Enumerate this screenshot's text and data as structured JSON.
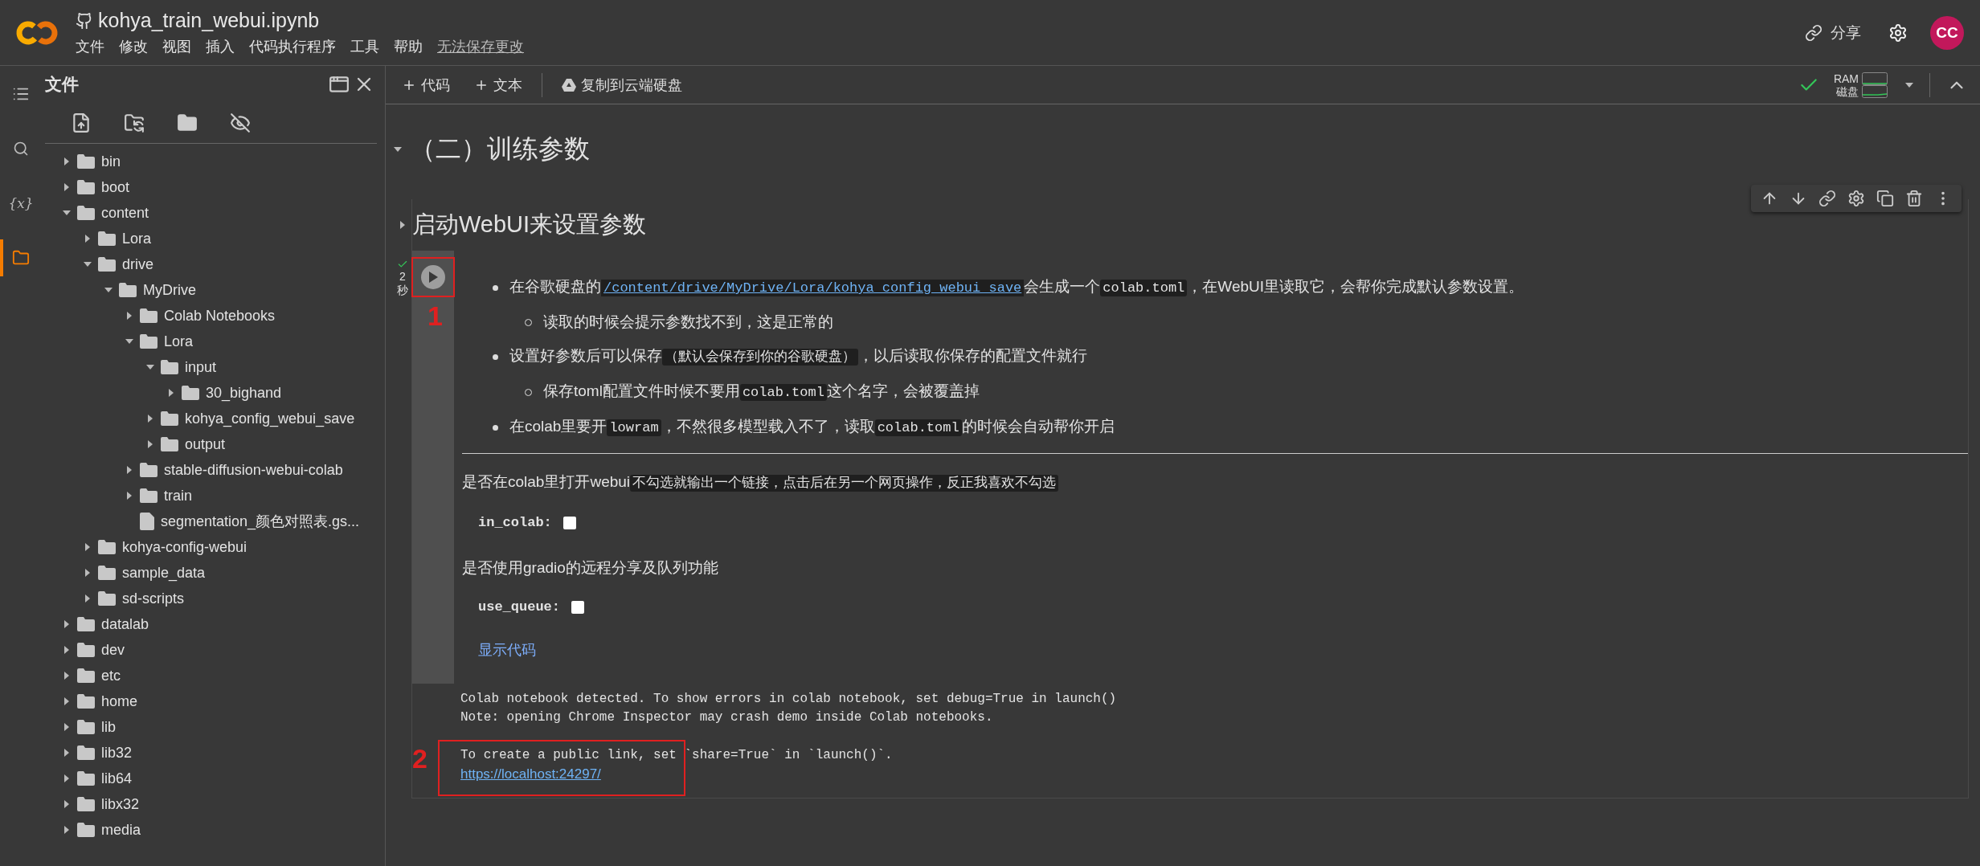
{
  "app": {
    "title": "kohya_train_webui.ipynb",
    "menu": [
      "文件",
      "修改",
      "视图",
      "插入",
      "代码执行程序",
      "工具",
      "帮助"
    ],
    "save_notice": "无法保存更改",
    "share": "分享",
    "avatar": "CC"
  },
  "toolbar": {
    "add_code": "代码",
    "add_text": "文本",
    "copy_to_drive": "复制到云端硬盘",
    "ram_label": "RAM",
    "disk_label": "磁盘",
    "connected": true
  },
  "rail": [
    {
      "kind": "toc",
      "selected": false
    },
    {
      "kind": "search",
      "selected": false
    },
    {
      "kind": "variables",
      "selected": false,
      "glyph": "{x}"
    },
    {
      "kind": "files",
      "selected": true
    }
  ],
  "sidebar": {
    "title": "文件"
  },
  "file_tree": [
    {
      "name": "bin",
      "kind": "folder",
      "expanded": false
    },
    {
      "name": "boot",
      "kind": "folder",
      "expanded": false
    },
    {
      "name": "content",
      "kind": "folder",
      "expanded": true,
      "children": [
        {
          "name": "Lora",
          "kind": "folder",
          "expanded": false
        },
        {
          "name": "drive",
          "kind": "folder",
          "expanded": true,
          "children": [
            {
              "name": "MyDrive",
              "kind": "folder",
              "expanded": true,
              "children": [
                {
                  "name": "Colab Notebooks",
                  "kind": "folder",
                  "expanded": false
                },
                {
                  "name": "Lora",
                  "kind": "folder",
                  "expanded": true,
                  "children": [
                    {
                      "name": "input",
                      "kind": "folder",
                      "expanded": true,
                      "children": [
                        {
                          "name": "30_bighand",
                          "kind": "folder",
                          "expanded": false
                        }
                      ]
                    },
                    {
                      "name": "kohya_config_webui_save",
                      "kind": "folder",
                      "expanded": false
                    },
                    {
                      "name": "output",
                      "kind": "folder",
                      "expanded": false
                    }
                  ]
                },
                {
                  "name": "stable-diffusion-webui-colab",
                  "kind": "folder",
                  "expanded": false
                },
                {
                  "name": "train",
                  "kind": "folder",
                  "expanded": false
                },
                {
                  "name": "segmentation_颜色对照表.gs...",
                  "kind": "file"
                }
              ]
            }
          ]
        },
        {
          "name": "kohya-config-webui",
          "kind": "folder",
          "expanded": false
        },
        {
          "name": "sample_data",
          "kind": "folder",
          "expanded": false
        },
        {
          "name": "sd-scripts",
          "kind": "folder",
          "expanded": false
        }
      ]
    },
    {
      "name": "datalab",
      "kind": "folder",
      "expanded": false
    },
    {
      "name": "dev",
      "kind": "folder",
      "expanded": false
    },
    {
      "name": "etc",
      "kind": "folder",
      "expanded": false
    },
    {
      "name": "home",
      "kind": "folder",
      "expanded": false
    },
    {
      "name": "lib",
      "kind": "folder",
      "expanded": false
    },
    {
      "name": "lib32",
      "kind": "folder",
      "expanded": false
    },
    {
      "name": "lib64",
      "kind": "folder",
      "expanded": false
    },
    {
      "name": "libx32",
      "kind": "folder",
      "expanded": false
    },
    {
      "name": "media",
      "kind": "folder",
      "expanded": false
    }
  ],
  "section": {
    "title": "（二）训练参数",
    "expanded": true
  },
  "cell": {
    "title": "启动WebUI来设置参数",
    "expanded": false,
    "succeeded": true,
    "duration_value": "2",
    "duration_unit": "秒",
    "bullets": [
      {
        "parts": [
          {
            "kind": "text",
            "text": "在谷歌硬盘的"
          },
          {
            "kind": "link",
            "text": "/content/drive/MyDrive/Lora/kohya_config_webui_save"
          },
          {
            "kind": "text",
            "text": "会生成一个"
          },
          {
            "kind": "code",
            "text": "colab.toml"
          },
          {
            "kind": "text",
            "text": "，在WebUI里读取它，会帮你完成默认参数设置。"
          }
        ],
        "children": [
          {
            "parts": [
              {
                "kind": "text",
                "text": "读取的时候会提示参数找不到，这是正常的"
              }
            ]
          }
        ]
      },
      {
        "parts": [
          {
            "kind": "text",
            "text": "设置好参数后可以保存"
          },
          {
            "kind": "code",
            "text": "（默认会保存到你的谷歌硬盘）"
          },
          {
            "kind": "text",
            "text": "，以后读取你保存的配置文件就行"
          }
        ],
        "children": [
          {
            "parts": [
              {
                "kind": "text",
                "text": "保存toml配置文件时候不要用"
              },
              {
                "kind": "code",
                "text": "colab.toml"
              },
              {
                "kind": "text",
                "text": "这个名字，会被覆盖掉"
              }
            ]
          }
        ]
      },
      {
        "parts": [
          {
            "kind": "text",
            "text": "在colab里要开"
          },
          {
            "kind": "code",
            "text": "lowram"
          },
          {
            "kind": "text",
            "text": "，不然很多模型载入不了，读取"
          },
          {
            "kind": "code",
            "text": "colab.toml"
          },
          {
            "kind": "text",
            "text": "的时候会自动帮你开启"
          }
        ]
      }
    ],
    "form": [
      {
        "description": [
          {
            "kind": "text",
            "text": "是否在colab里打开webui"
          },
          {
            "kind": "code",
            "text": "不勾选就输出一个链接，点击后在另一个网页操作，反正我喜欢不勾选"
          }
        ],
        "param": "in_colab:",
        "checked": false
      },
      {
        "description": [
          {
            "kind": "text",
            "text": "是否使用gradio的远程分享及队列功能"
          }
        ],
        "param": "use_queue:",
        "checked": false
      }
    ],
    "show_code": "显示代码",
    "output": [
      {
        "kind": "text",
        "text": "Colab notebook detected. To show errors in colab notebook, set debug=True in launch()"
      },
      {
        "kind": "text",
        "text": "Note: opening Chrome Inspector may crash demo inside Colab notebooks."
      },
      {
        "kind": "gap"
      },
      {
        "kind": "text",
        "text": "To create a public link, set `share=True` in `launch()`."
      },
      {
        "kind": "link",
        "text": "https://localhost:24297/"
      }
    ]
  },
  "annotations": [
    {
      "label": "1"
    },
    {
      "label": "2"
    }
  ]
}
